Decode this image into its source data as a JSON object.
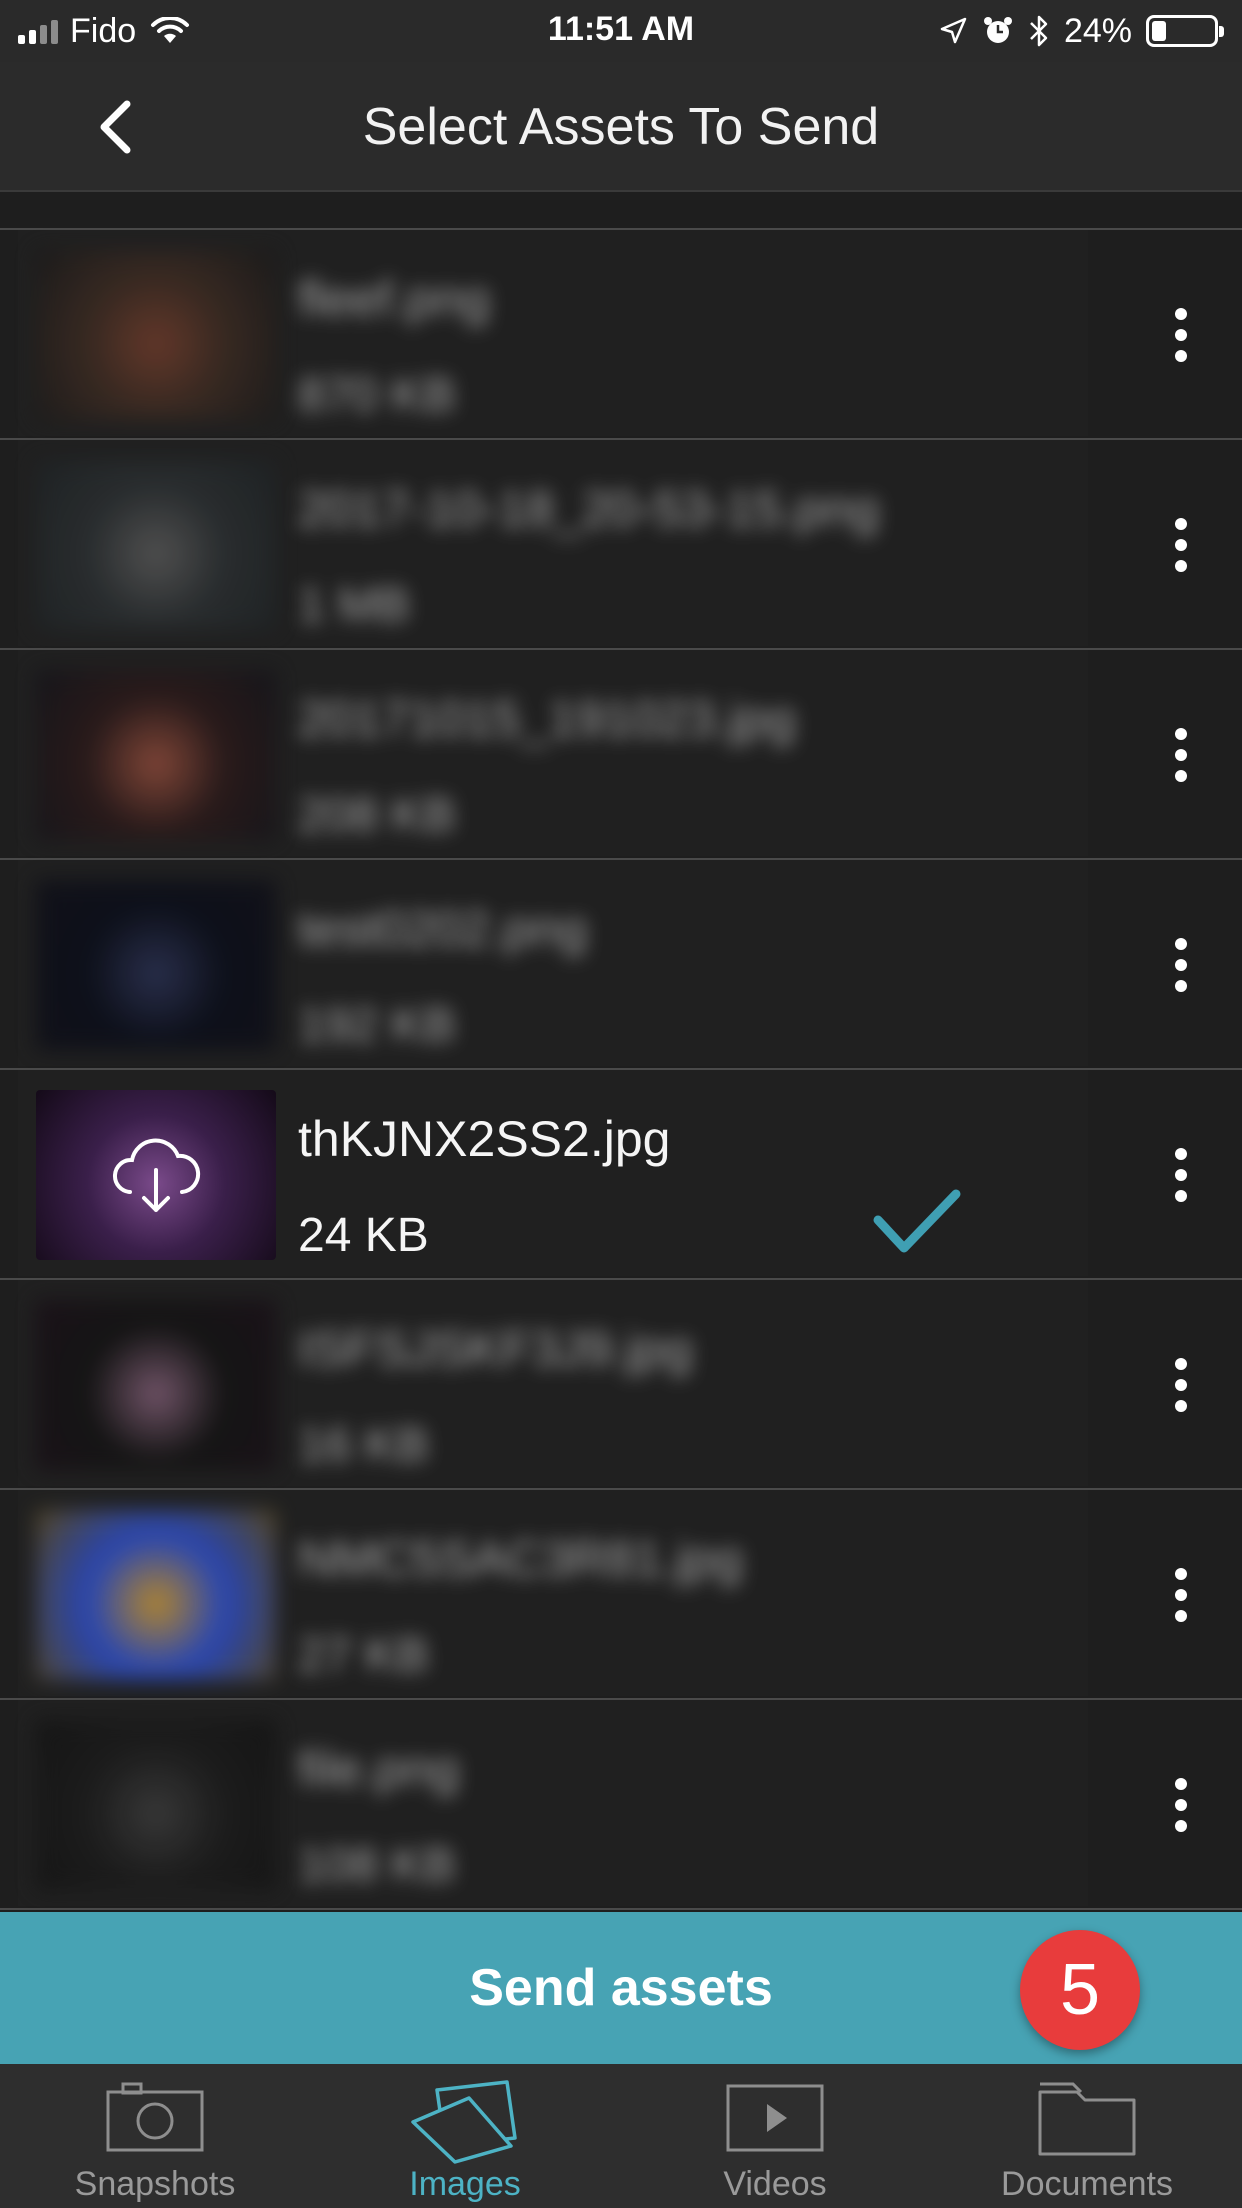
{
  "status_bar": {
    "carrier": "Fido",
    "time": "11:51 AM",
    "battery": "24%",
    "battery_level": 0.24
  },
  "header": {
    "title": "Select Assets To Send",
    "back_icon": "chevron-left-icon"
  },
  "assets": [
    {
      "name": "fleef.png",
      "size": "870 KB",
      "selected": false,
      "blurred": true,
      "thumb_colors": [
        "#3a2a22",
        "#1a1a1a",
        "#6a3a2a"
      ]
    },
    {
      "name": "2017-10-18_20-53-15.png",
      "size": "1 MB",
      "selected": false,
      "blurred": true,
      "thumb_colors": [
        "#2a2e30",
        "#1e2224",
        "#555555"
      ]
    },
    {
      "name": "20171015_191023.jpg",
      "size": "208 KB",
      "selected": false,
      "blurred": true,
      "thumb_colors": [
        "#2a1a1a",
        "#14141a",
        "#8a4a3a"
      ]
    },
    {
      "name": "test0202.png",
      "size": "192 KB",
      "selected": false,
      "blurred": true,
      "thumb_colors": [
        "#0c0f1a",
        "#101018",
        "#2a3050"
      ]
    },
    {
      "name": "thKJNX2SS2.jpg",
      "size": "24 KB",
      "selected": true,
      "blurred": false,
      "thumb_colors": [
        "#3a1f4a",
        "#140a18",
        "#7a4a8a"
      ]
    },
    {
      "name": "ISFSJSKF3J9.jpg",
      "size": "16 KB",
      "selected": false,
      "blurred": true,
      "thumb_colors": [
        "#141414",
        "#1a1018",
        "#7a5a70"
      ]
    },
    {
      "name": "NMC5SAC3R81.jpg",
      "size": "27 KB",
      "selected": false,
      "blurred": true,
      "thumb_colors": [
        "#2a4ac0",
        "#5a4a20",
        "#c09030"
      ]
    },
    {
      "name": "file.png",
      "size": "108 KB",
      "selected": false,
      "blurred": true,
      "thumb_colors": [
        "#1c1c1c",
        "#141414",
        "#3a3a3a"
      ]
    }
  ],
  "send_button": {
    "label": "Send assets",
    "badge_count": "5"
  },
  "tabs": [
    {
      "label": "Snapshots",
      "icon": "camera-icon",
      "active": false
    },
    {
      "label": "Images",
      "icon": "images-icon",
      "active": true
    },
    {
      "label": "Videos",
      "icon": "video-icon",
      "active": false
    },
    {
      "label": "Documents",
      "icon": "folder-icon",
      "active": false
    }
  ],
  "colors": {
    "accent": "#47a3b4",
    "active_tab": "#4db3c5",
    "badge": "#e83c3c",
    "check": "#3f9fb3"
  }
}
